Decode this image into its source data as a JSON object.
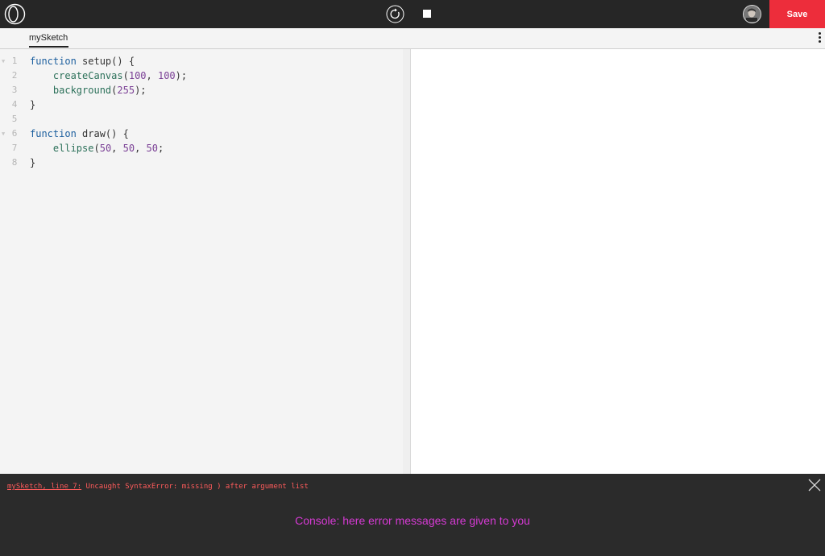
{
  "header": {
    "save_label": "Save",
    "logo_icon": "p5-logo-icon",
    "run_icon": "reload-icon",
    "stop_icon": "stop-icon",
    "avatar_icon": "user-avatar"
  },
  "tabs": [
    {
      "label": "mySketch",
      "active": true
    }
  ],
  "editor": {
    "lines": [
      {
        "n": "1",
        "fold": "▼"
      },
      {
        "n": "2",
        "fold": ""
      },
      {
        "n": "3",
        "fold": ""
      },
      {
        "n": "4",
        "fold": ""
      },
      {
        "n": "5",
        "fold": ""
      },
      {
        "n": "6",
        "fold": "▼"
      },
      {
        "n": "7",
        "fold": ""
      },
      {
        "n": "8",
        "fold": ""
      }
    ],
    "code": {
      "l1_kw": "function",
      "l1_rest": " setup() {",
      "l2_fn": "createCanvas",
      "l2_a": "(",
      "l2_n1": "100",
      "l2_b": ", ",
      "l2_n2": "100",
      "l2_c": ");",
      "l3_fn": "background",
      "l3_a": "(",
      "l3_n1": "255",
      "l3_c": ");",
      "l4": "}",
      "l6_kw": "function",
      "l6_rest": " draw() {",
      "l7_fn": "ellipse",
      "l7_a": "(",
      "l7_n1": "50",
      "l7_b": ", ",
      "l7_n2": "50",
      "l7_c": ", ",
      "l7_n3": "50",
      "l7_d": ";",
      "l8": "}"
    }
  },
  "console": {
    "error_location": "mySketch, line 7:",
    "error_message": " Uncaught SyntaxError: missing ) after argument list",
    "annotation": "Console: here error messages are given to you",
    "close_icon": "close-icon"
  },
  "colors": {
    "topbar": "#262626",
    "save": "#ed2d3b",
    "error": "#ff5b5b",
    "annotation": "#d63ad4"
  }
}
